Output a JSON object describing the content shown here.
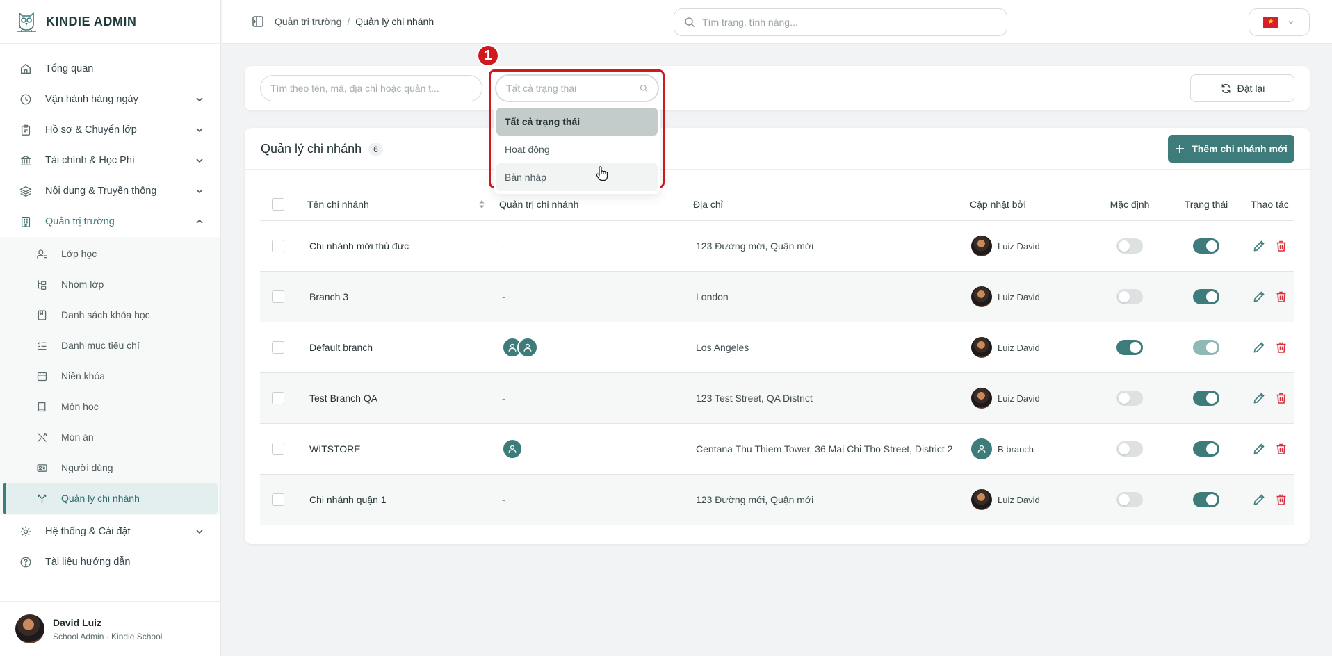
{
  "sidebar": {
    "brand": "KINDIE ADMIN",
    "items": [
      {
        "label": "Tổng quan",
        "icon": "home-icon"
      },
      {
        "label": "Vận hành hàng ngày",
        "icon": "clock-icon"
      },
      {
        "label": "Hồ sơ & Chuyển lớp",
        "icon": "clipboard-icon"
      },
      {
        "label": "Tài chính & Học Phí",
        "icon": "bank-icon"
      },
      {
        "label": "Nội dung & Truyền thông",
        "icon": "layers-icon"
      },
      {
        "label": "Quản trị trường",
        "icon": "building-icon"
      }
    ],
    "sub_items": [
      {
        "label": "Lớp học",
        "icon": "user-class-icon"
      },
      {
        "label": "Nhóm lớp",
        "icon": "group-tree-icon"
      },
      {
        "label": "Danh sách khóa học",
        "icon": "book-icon"
      },
      {
        "label": "Danh mục tiêu chí",
        "icon": "checklist-icon"
      },
      {
        "label": "Niên khóa",
        "icon": "calendar-icon"
      },
      {
        "label": "Môn học",
        "icon": "notebook-icon"
      },
      {
        "label": "Món ăn",
        "icon": "utensils-icon"
      },
      {
        "label": "Người dùng",
        "icon": "id-card-icon"
      },
      {
        "label": "Quản lý chi nhánh",
        "icon": "branch-icon"
      }
    ],
    "bottom_items": [
      {
        "label": "Hệ thống & Cài đặt",
        "icon": "gear-icon"
      },
      {
        "label": "Tài liệu hướng dẫn",
        "icon": "help-icon"
      }
    ],
    "user": {
      "name": "David Luiz",
      "role": "School Admin · Kindie School"
    }
  },
  "topbar": {
    "breadcrumb": [
      "Quản trị trường",
      "Quản lý chi nhánh"
    ],
    "search_placeholder": "Tìm trang, tính năng...",
    "flag_star": "★"
  },
  "filter": {
    "search_placeholder": "Tìm theo tên, mã, địa chỉ hoặc quản t...",
    "status_placeholder": "Tất cả trạng thái",
    "status_options": [
      "Tất cả trạng thái",
      "Hoạt động",
      "Bản nháp"
    ],
    "reset_label": "Đặt lại",
    "annotation_number": "1"
  },
  "table": {
    "title": "Quản lý chi nhánh",
    "count": "6",
    "add_label": "Thêm chi nhánh mới",
    "columns": [
      "Tên chi nhánh",
      "Quản trị chi nhánh",
      "Địa chỉ",
      "Cập nhật bởi",
      "Mặc định",
      "Trạng thái",
      "Thao tác"
    ],
    "rows": [
      {
        "name": "Chi nhánh mới thủ đức",
        "admin": "-",
        "admins_count": 0,
        "address": "123 Đường mới, Quận mới",
        "updated_by": "Luiz David",
        "updater_avatar": "photo",
        "default": false,
        "status": "on"
      },
      {
        "name": "Branch 3",
        "admin": "-",
        "admins_count": 0,
        "address": "London",
        "updated_by": "Luiz David",
        "updater_avatar": "photo",
        "default": false,
        "status": "on"
      },
      {
        "name": "Default branch",
        "admin": "",
        "admins_count": 2,
        "address": "Los Angeles",
        "updated_by": "Luiz David",
        "updater_avatar": "photo",
        "default": true,
        "status": "dim"
      },
      {
        "name": "Test Branch QA",
        "admin": "-",
        "admins_count": 0,
        "address": "123 Test Street, QA District",
        "updated_by": "Luiz David",
        "updater_avatar": "photo",
        "default": false,
        "status": "on"
      },
      {
        "name": "WITSTORE",
        "admin": "",
        "admins_count": 1,
        "address": "Centana Thu Thiem Tower, 36 Mai Chi Tho Street, District 2",
        "updated_by": "B branch",
        "updater_avatar": "icon",
        "default": false,
        "status": "on"
      },
      {
        "name": "Chi nhánh quận 1",
        "admin": "-",
        "admins_count": 0,
        "address": "123 Đường mới, Quận mới",
        "updated_by": "Luiz David",
        "updater_avatar": "photo",
        "default": false,
        "status": "on"
      }
    ]
  },
  "colors": {
    "accent": "#3d7c7b",
    "danger": "#d9323f",
    "highlight": "#d0191f"
  }
}
